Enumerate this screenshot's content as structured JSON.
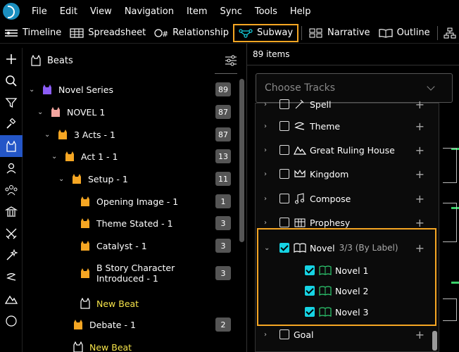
{
  "menu": [
    "File",
    "Edit",
    "View",
    "Navigation",
    "Item",
    "Sync",
    "Tools",
    "Help"
  ],
  "toolbar": {
    "timeline": "Timeline",
    "spreadsheet": "Spreadsheet",
    "relationship": "Relationship",
    "subway": "Subway",
    "narrative": "Narrative",
    "outline": "Outline"
  },
  "beats": {
    "title": "Beats",
    "rows": [
      {
        "label": "Novel Series",
        "count": "89",
        "color": "#8b5cf6"
      },
      {
        "label": "NOVEL 1",
        "count": "87",
        "color": "#f4a6a0"
      },
      {
        "label": "3 Acts - 1",
        "count": "87",
        "color": "#f5a623"
      },
      {
        "label": "Act 1 - 1",
        "count": "13",
        "color": "#f5a623"
      },
      {
        "label": "Setup - 1",
        "count": "11",
        "color": "#f5a623"
      },
      {
        "label": "Opening Image - 1",
        "count": "1",
        "color": "#f5a623"
      },
      {
        "label": "Theme Stated - 1",
        "count": "3",
        "color": "#f5a623"
      },
      {
        "label": "Catalyst - 1",
        "count": "3",
        "color": "#f5a623"
      },
      {
        "label": "B Story Character\nIntroduced - 1",
        "count": "3",
        "color": "#f5a623"
      },
      {
        "label": "New Beat",
        "count": "",
        "color": "#ffffff"
      },
      {
        "label": "Debate - 1",
        "count": "2",
        "color": "#f5a623"
      },
      {
        "label": "New Beat",
        "count": "",
        "color": "#ffffff"
      }
    ]
  },
  "subway": {
    "items_count": "89 items",
    "choose_placeholder": "Choose Tracks",
    "tracks": [
      {
        "label": "Spell",
        "checked": false
      },
      {
        "label": "Theme",
        "checked": false
      },
      {
        "label": "Great Ruling House",
        "checked": false
      },
      {
        "label": "Kingdom",
        "checked": false
      },
      {
        "label": "Compose",
        "checked": false
      },
      {
        "label": "Prophesy",
        "checked": false
      },
      {
        "label": "Novel",
        "sub": "3/3 (By Label)",
        "checked": true
      },
      {
        "label": "Novel 1",
        "checked": true
      },
      {
        "label": "Novel 2",
        "checked": true
      },
      {
        "label": "Novel 3",
        "checked": true
      },
      {
        "label": "Goal",
        "checked": false
      }
    ]
  },
  "colors": {
    "accent": "#f5a623",
    "selected_rail": "#2456c7",
    "check": "#16d3e3",
    "subway_line": "#3bd06a"
  }
}
